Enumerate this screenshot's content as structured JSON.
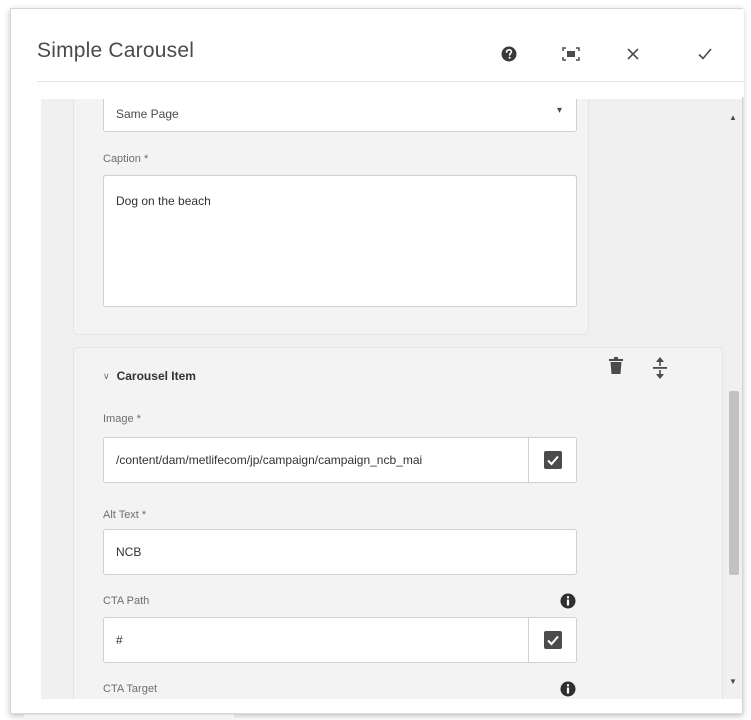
{
  "dialog": {
    "title": "Simple Carousel",
    "actions": {
      "help_icon": "help-circle-icon",
      "fullscreen_icon": "fullscreen-icon",
      "close_icon": "close-icon",
      "done_icon": "checkmark-icon"
    }
  },
  "item1": {
    "target_value": "Same Page",
    "caption_label": "Caption *",
    "caption_value": "Dog on the beach"
  },
  "item2": {
    "heading": "Carousel Item",
    "image_label": "Image *",
    "image_value": "/content/dam/metlifecom/jp/campaign/campaign_ncb_mai",
    "alt_label": "Alt Text *",
    "alt_value": "NCB",
    "cta_path_label": "CTA Path",
    "cta_path_value": "#",
    "cta_target_label": "CTA Target"
  },
  "colors": {
    "panel_bg": "#f0f0f0",
    "field_border": "#d0d0d0",
    "icon": "#4b4b4b"
  }
}
